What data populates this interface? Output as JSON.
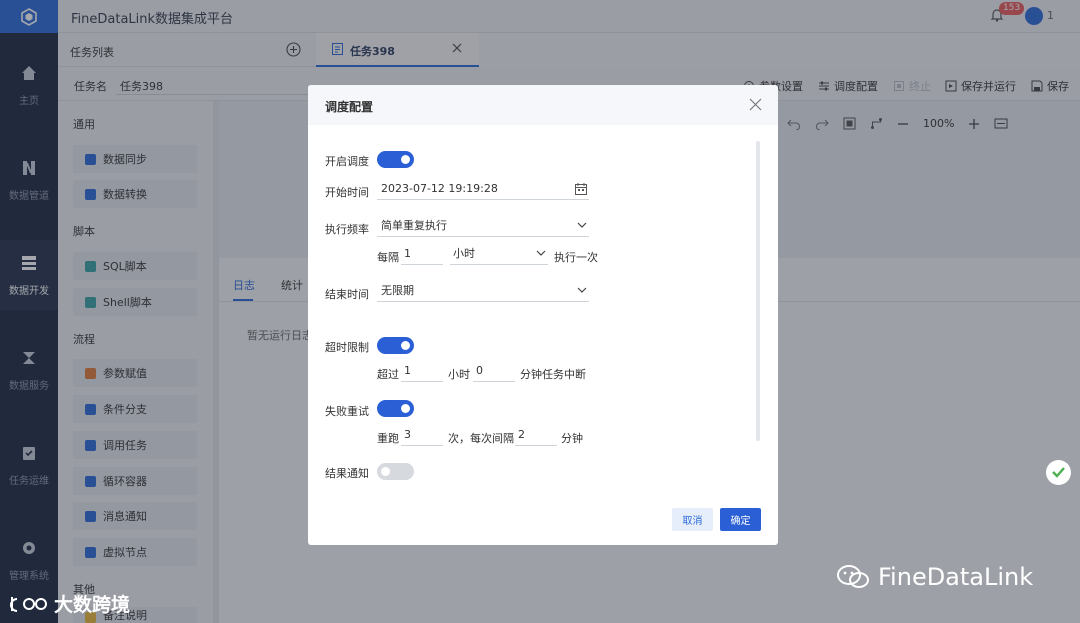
{
  "app": {
    "title": "FineDataLink数据集成平台",
    "notification_count": "153",
    "user_label": "1"
  },
  "nav": {
    "items": [
      {
        "label": "主页",
        "icon": "home-icon"
      },
      {
        "label": "数据管道",
        "icon": "pipeline-icon"
      },
      {
        "label": "数据开发",
        "icon": "dev-icon"
      },
      {
        "label": "数据服务",
        "icon": "service-icon"
      },
      {
        "label": "任务运维",
        "icon": "ops-icon"
      },
      {
        "label": "管理系统",
        "icon": "gear-icon"
      }
    ]
  },
  "tasklist": {
    "title": "任务列表"
  },
  "tab": {
    "label": "任务398"
  },
  "taskname": {
    "label": "任务名",
    "value": "任务398"
  },
  "toolbar": {
    "param_settings": "参数设置",
    "schedule_config": "调度配置",
    "stop": "终止",
    "save_and_run": "保存并运行",
    "save": "保存"
  },
  "sidebar": {
    "groups": [
      {
        "title": "通用",
        "items": [
          "数据同步",
          "数据转换"
        ]
      },
      {
        "title": "脚本",
        "items": [
          "SQL脚本",
          "Shell脚本"
        ]
      },
      {
        "title": "流程",
        "items": [
          "参数赋值",
          "条件分支",
          "调用任务",
          "循环容器",
          "消息通知",
          "虚拟节点"
        ]
      },
      {
        "title": "其他",
        "items": [
          "备注说明"
        ]
      }
    ]
  },
  "canvas": {
    "zoom": "100%"
  },
  "log": {
    "tabs": [
      "日志",
      "统计"
    ],
    "empty_text": "暂无运行日志"
  },
  "modal": {
    "title": "调度配置",
    "enable_schedule": {
      "label": "开启调度",
      "on": true
    },
    "start_time": {
      "label": "开始时间",
      "value": "2023-07-12 19:19:28"
    },
    "frequency": {
      "label": "执行频率",
      "value": "简单重复执行"
    },
    "interval": {
      "prefix": "每隔",
      "value": "1",
      "unit": "小时",
      "suffix": "执行一次"
    },
    "end_time": {
      "label": "结束时间",
      "value": "无限期"
    },
    "timeout": {
      "label": "超时限制",
      "on": true,
      "prefix": "超过",
      "hours": "1",
      "hours_unit": "小时",
      "minutes": "0",
      "suffix": "分钟任务中断"
    },
    "retry": {
      "label": "失败重试",
      "on": true,
      "prefix": "重跑",
      "times": "3",
      "mid": "次，每次间隔",
      "interval": "2",
      "suffix": "分钟"
    },
    "notify": {
      "label": "结果通知",
      "on": false
    },
    "cancel": "取消",
    "ok": "确定"
  },
  "watermarks": {
    "left": "大数跨境",
    "right": "FineDataLink"
  }
}
